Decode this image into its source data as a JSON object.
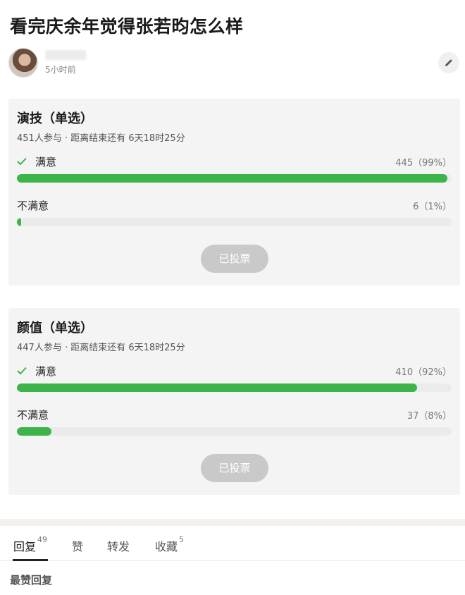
{
  "post": {
    "title": "看完庆余年觉得张若昀怎么样",
    "time": "5小时前"
  },
  "polls": [
    {
      "title": "演技（单选）",
      "meta": "451人参与 · 距离结束还有 6天18时25分",
      "options": [
        {
          "label": "满意",
          "count": "445（99%）",
          "percent": 99,
          "selected": true
        },
        {
          "label": "不满意",
          "count": "6（1%）",
          "percent": 1,
          "selected": false
        }
      ],
      "button": "已投票"
    },
    {
      "title": "颜值（单选）",
      "meta": "447人参与 · 距离结束还有 6天18时25分",
      "options": [
        {
          "label": "满意",
          "count": "410（92%）",
          "percent": 92,
          "selected": true
        },
        {
          "label": "不满意",
          "count": "37（8%）",
          "percent": 8,
          "selected": false
        }
      ],
      "button": "已投票"
    }
  ],
  "tabs": [
    {
      "label": "回复",
      "count": "49"
    },
    {
      "label": "赞",
      "count": ""
    },
    {
      "label": "转发",
      "count": ""
    },
    {
      "label": "收藏",
      "count": "5"
    }
  ],
  "section": {
    "top_replies": "最赞回复"
  },
  "colors": {
    "bar_fill": "#3cb449",
    "bar_track": "#ebebeb",
    "voted_button": "#c9c9c9"
  },
  "icons": {
    "check": "check-icon",
    "edit": "pencil-icon"
  }
}
